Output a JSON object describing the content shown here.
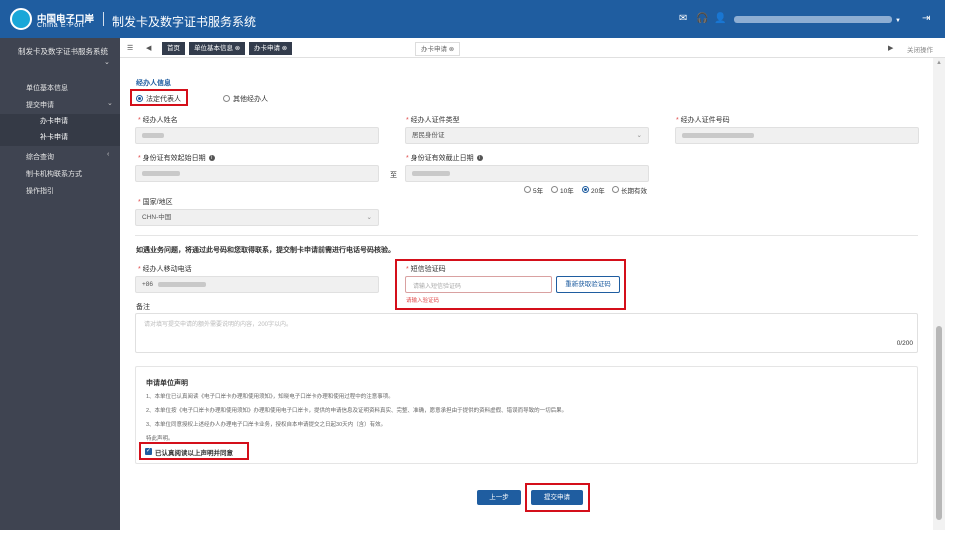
{
  "header": {
    "logo_cn": "中国电子口岸",
    "logo_en": "China E-Port",
    "app_title": "制发卡及数字证书服务系统",
    "icons": [
      "mail-icon",
      "headset-icon",
      "user-icon",
      "logout-icon"
    ],
    "user_caret": "▼"
  },
  "sidebar": {
    "title": "制发卡及数字证书服务系统",
    "items": [
      {
        "label": "单位基本信息"
      },
      {
        "label": "提交申请"
      },
      {
        "label": "办卡申请"
      },
      {
        "label": "补卡申请"
      },
      {
        "label": "综合查询"
      },
      {
        "label": "制卡机构联系方式"
      },
      {
        "label": "操作指引"
      }
    ]
  },
  "tabs": {
    "home": "首页",
    "items": [
      {
        "label": "单位基本信息"
      },
      {
        "label": "办卡申请"
      },
      {
        "label": "办卡申请"
      }
    ],
    "close_ops": "关闭操作"
  },
  "form": {
    "section_title": "经办人信息",
    "radio_legal": "法定代表人",
    "radio_other": "其他经办人",
    "name_label": "经办人姓名",
    "idtype_label": "经办人证件类型",
    "idtype_value": "居民身份证",
    "idno_label": "经办人证件号码",
    "start_label": "身份证有效起始日期",
    "end_label": "身份证有效截止日期",
    "to_text": "至",
    "validity_options": [
      "5年",
      "10年",
      "20年",
      "长期有效"
    ],
    "region_label": "国家/地区",
    "region_value": "CHN-中国",
    "notice": "如遇业务问题，将通过此号码和您取得联系，提交制卡申请前需进行电话号码核验。",
    "phone_label": "经办人移动电话",
    "phone_prefix": "+86",
    "sms_label": "短信验证码",
    "sms_placeholder": "请输入短信验证码",
    "sms_button": "重新获取验证码",
    "sms_error": "请输入验证码",
    "remark_label": "备注",
    "remark_placeholder": "请对填写提交申请的额外需要说明的内容，200字以内。",
    "remark_count": "0/200"
  },
  "declaration": {
    "title": "申请单位声明",
    "lines": [
      "1、本单位已认真阅读《电子口岸卡办理和使用须知》，知晓电子口岸卡办理和使用过程中的注意事项。",
      "2、本单位按《电子口岸卡办理和使用须知》办理和使用电子口岸卡，提供的申请信息及证明资料真实、完整、准确，愿意承担由于提供的资料虚假、错误而导致的一切后果。",
      "3、本单位同意授权上述经办人办理电子口岸卡业务，授权自本申请提交之日起30天内（含）有效。",
      "特此声明。"
    ],
    "agree_label": "已认真阅读以上声明并同意"
  },
  "actions": {
    "prev": "上一步",
    "submit": "提交申请"
  }
}
